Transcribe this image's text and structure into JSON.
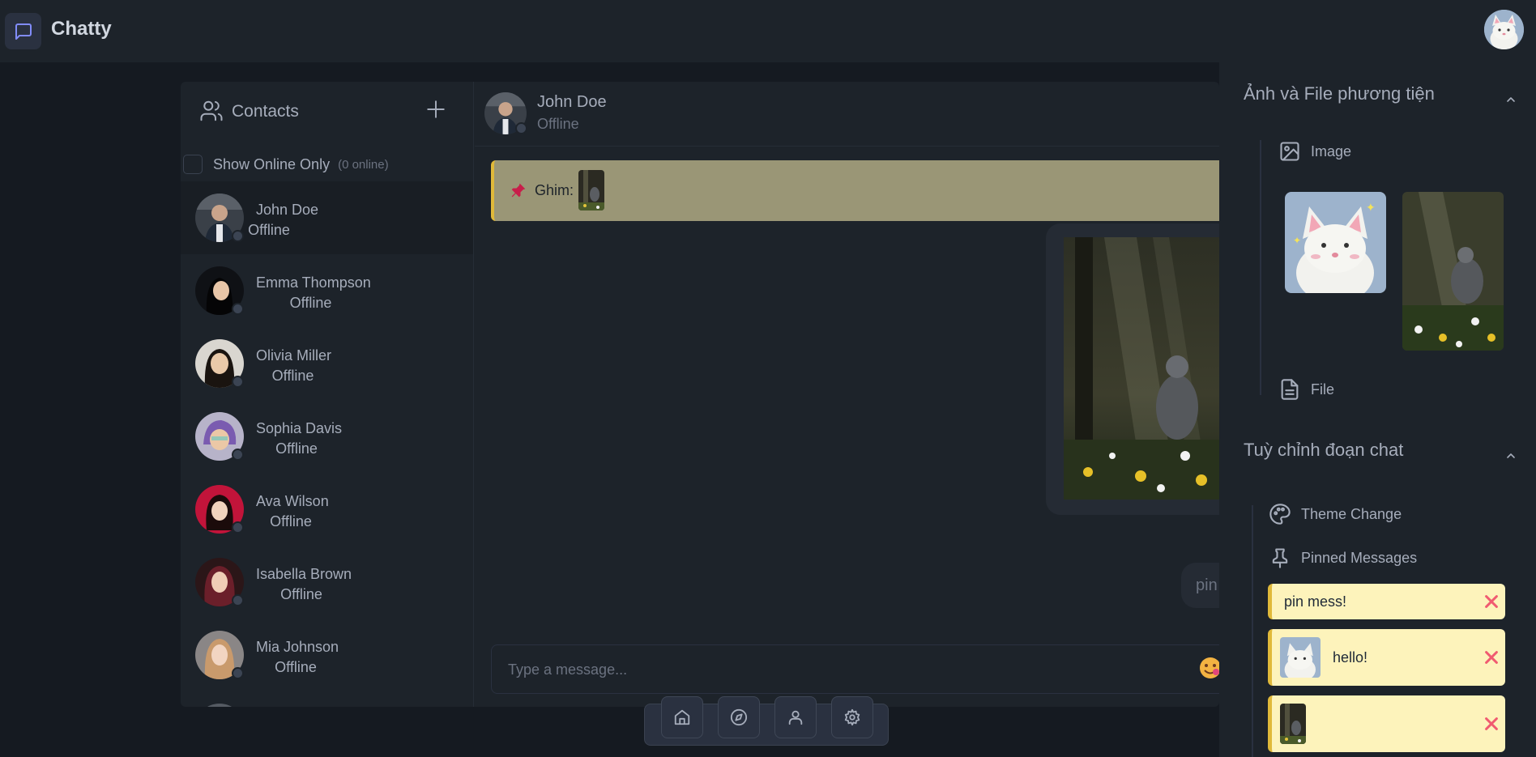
{
  "app": {
    "title": "Chatty"
  },
  "contacts": {
    "title": "Contacts",
    "show_online_label": "Show Online Only",
    "online_count": "(0 online)",
    "items": [
      {
        "name": "John Doe",
        "status": "Offline"
      },
      {
        "name": "Emma Thompson",
        "status": "Offline"
      },
      {
        "name": "Olivia Miller",
        "status": "Offline"
      },
      {
        "name": "Sophia Davis",
        "status": "Offline"
      },
      {
        "name": "Ava Wilson",
        "status": "Offline"
      },
      {
        "name": "Isabella Brown",
        "status": "Offline"
      },
      {
        "name": "Mia Johnson",
        "status": "Offline"
      }
    ]
  },
  "chat": {
    "contact_name": "John Doe",
    "contact_status": "Offline",
    "pinned_label": "Ghim:",
    "messages": [
      {
        "type": "image"
      },
      {
        "type": "text",
        "text": "pin"
      }
    ],
    "input_placeholder": "Type a message..."
  },
  "right_panel": {
    "media_title": "Ảnh và File phương tiện",
    "image_label": "Image",
    "file_label": "File",
    "customize_title": "Tuỳ chỉnh đoạn chat",
    "theme_label": "Theme Change",
    "pinned_label": "Pinned Messages",
    "pinned_items": [
      {
        "text": "pin mess!"
      },
      {
        "text": "hello!"
      },
      {
        "text": ""
      }
    ]
  },
  "colors": {
    "accent": "#818cf8",
    "pin_bar": "#9a9676",
    "pin_card": "#fdf3bb",
    "remove": "#f05a70"
  }
}
